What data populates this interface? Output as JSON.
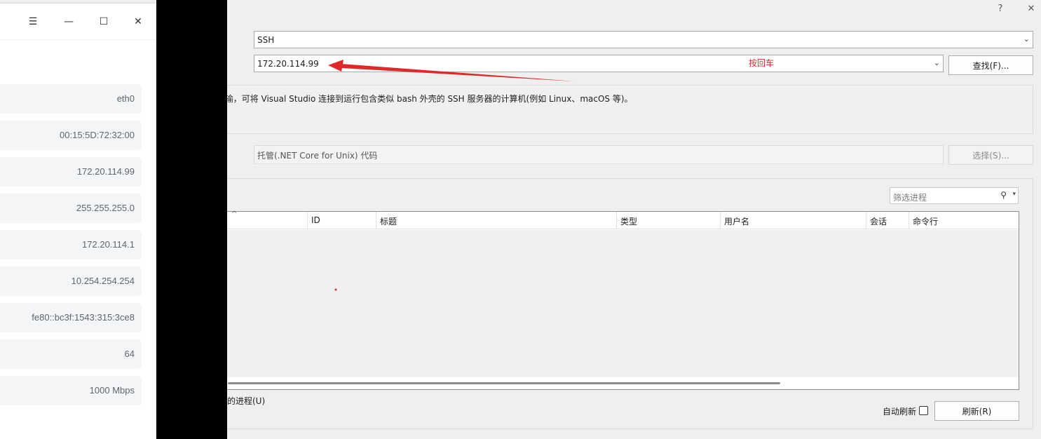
{
  "dialog": {
    "help_icon": "?",
    "close_icon": "✕",
    "connection_type": {
      "value": "SSH"
    },
    "target": {
      "value": "172.20.114.99"
    },
    "find_button": "查找(F)...",
    "info_text": "壳)传输，可将 Visual Studio 连接到运行包含类似 bash 外壳的 SSH 服务器的计算机(例如 Linux、macOS 等)。",
    "code_type": "托管(.NET Core for Unix) 代码",
    "select_button": "选择(S)...",
    "filter_placeholder": "筛选进程",
    "table": {
      "columns": [
        "ID",
        "标题",
        "类型",
        "用户名",
        "会话",
        "命令行"
      ]
    },
    "all_users_label": "的进程(U)",
    "auto_refresh_label": "自动刷新",
    "refresh_button": "刷新(R)"
  },
  "annotation": {
    "text": "按回车",
    "color": "#e0282a"
  },
  "network_window": {
    "menu_icon": "☰",
    "minimize_icon": "—",
    "maximize_icon": "☐",
    "close_icon": "✕",
    "values": [
      "eth0",
      "00:15:5D:72:32:00",
      "172.20.114.99",
      "255.255.255.0",
      "172.20.114.1",
      "10.254.254.254",
      "fe80::bc3f:1543:315:3ce8",
      "64",
      "1000 Mbps"
    ]
  }
}
